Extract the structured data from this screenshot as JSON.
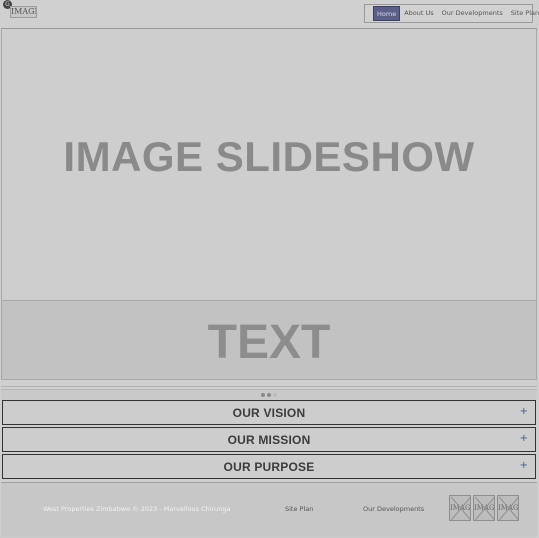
{
  "header": {
    "badge": "G",
    "logo_alt": "IMAGE",
    "nav": [
      "Home",
      "About Us",
      "Our Developments",
      "Site Plan"
    ]
  },
  "hero": {
    "title": "IMAGE SLIDESHOW",
    "caption": "TEXT",
    "slide_count": 3,
    "active_slide": 1
  },
  "accordion": [
    {
      "label": "OUR VISION",
      "icon": "+"
    },
    {
      "label": "OUR MISSION",
      "icon": "+"
    },
    {
      "label": "OUR PURPOSE",
      "icon": "+"
    }
  ],
  "footer": {
    "copyright": "West Properties Zimbabwe © 2023 - Marvellous Chirunga",
    "links": [
      "Site Plan",
      "Our Developments"
    ],
    "images": [
      "IMAGE",
      "IMAGE",
      "IMAGE"
    ]
  },
  "colors": {
    "active_nav_bg": "#5a5f8a",
    "plus_icon": "#4a5a8a"
  }
}
